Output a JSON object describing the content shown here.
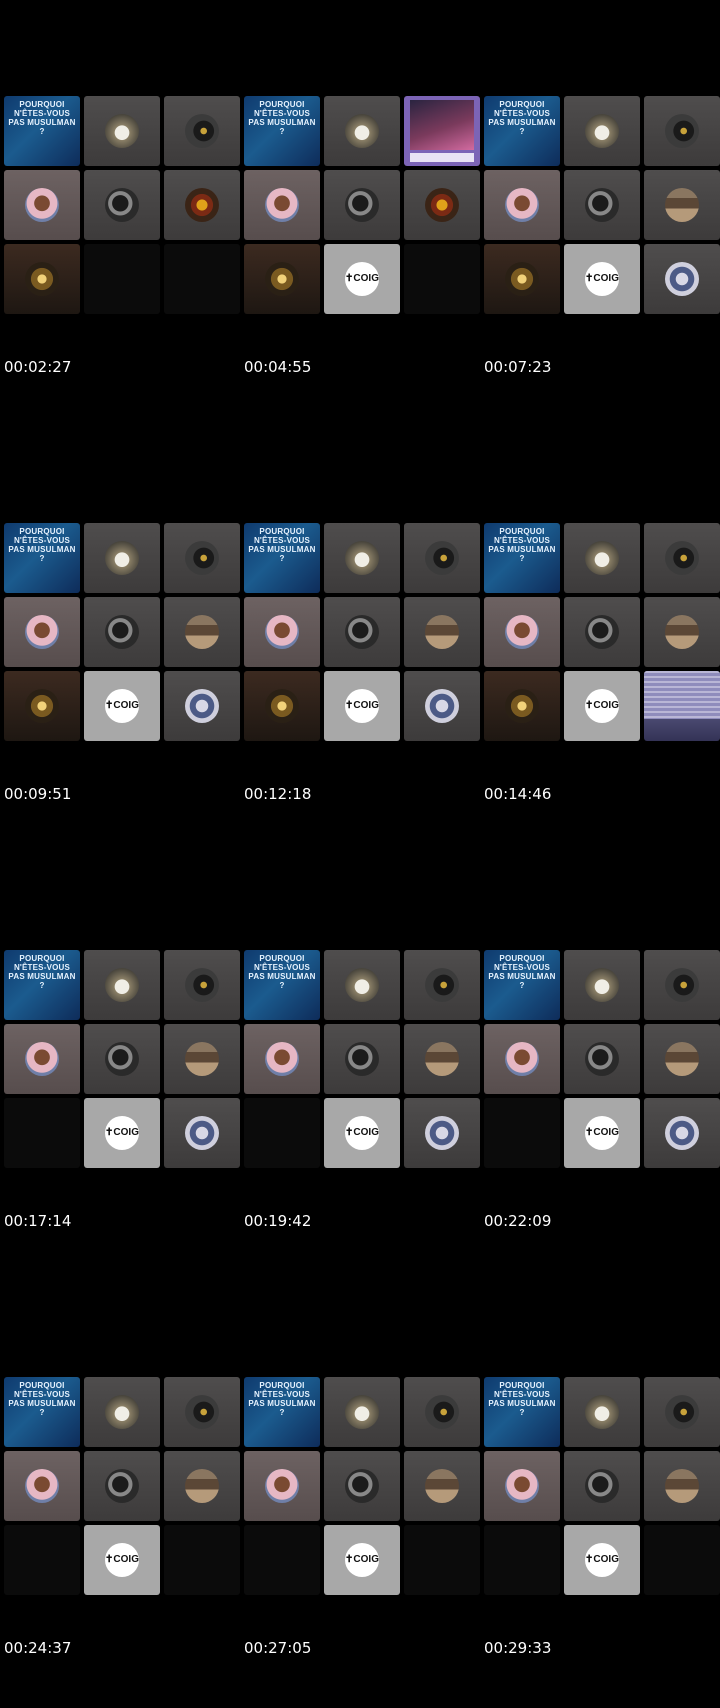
{
  "poster_text": "POURQUOI N'ÊTES-VOUS PAS MUSULMAN ?",
  "logo_text": "✝COIG",
  "thumbnails": [
    {
      "timestamp": "00:02:27",
      "tiles": [
        {
          "kind": "poster",
          "avatar": ""
        },
        {
          "kind": "grey",
          "avatar": "priest"
        },
        {
          "kind": "grey",
          "avatar": "bird"
        },
        {
          "kind": "pink",
          "avatar": "kid"
        },
        {
          "kind": "grey",
          "avatar": "dark"
        },
        {
          "kind": "grey",
          "avatar": "icon"
        },
        {
          "kind": "warm",
          "avatar": "bell"
        },
        {
          "kind": "black",
          "avatar": ""
        },
        {
          "kind": "black",
          "avatar": ""
        }
      ]
    },
    {
      "timestamp": "00:04:55",
      "tiles": [
        {
          "kind": "poster",
          "avatar": ""
        },
        {
          "kind": "grey",
          "avatar": "priest"
        },
        {
          "kind": "card",
          "avatar": ""
        },
        {
          "kind": "pink",
          "avatar": "kid"
        },
        {
          "kind": "grey",
          "avatar": "dark"
        },
        {
          "kind": "grey",
          "avatar": "icon"
        },
        {
          "kind": "warm",
          "avatar": "bell"
        },
        {
          "kind": "bright",
          "avatar": "logo"
        },
        {
          "kind": "black",
          "avatar": ""
        }
      ]
    },
    {
      "timestamp": "00:07:23",
      "tiles": [
        {
          "kind": "poster",
          "avatar": ""
        },
        {
          "kind": "grey",
          "avatar": "priest"
        },
        {
          "kind": "grey",
          "avatar": "bird"
        },
        {
          "kind": "pink",
          "avatar": "kid"
        },
        {
          "kind": "grey",
          "avatar": "dark"
        },
        {
          "kind": "grey",
          "avatar": "church"
        },
        {
          "kind": "warm",
          "avatar": "bell"
        },
        {
          "kind": "bright",
          "avatar": "logo"
        },
        {
          "kind": "grey",
          "avatar": "stand"
        }
      ]
    },
    {
      "timestamp": "00:09:51",
      "tiles": [
        {
          "kind": "poster",
          "avatar": ""
        },
        {
          "kind": "grey",
          "avatar": "priest"
        },
        {
          "kind": "grey",
          "avatar": "bird"
        },
        {
          "kind": "pink",
          "avatar": "kid"
        },
        {
          "kind": "grey",
          "avatar": "dark"
        },
        {
          "kind": "grey",
          "avatar": "church"
        },
        {
          "kind": "warm",
          "avatar": "bell"
        },
        {
          "kind": "bright",
          "avatar": "logo"
        },
        {
          "kind": "grey",
          "avatar": "stand"
        }
      ]
    },
    {
      "timestamp": "00:12:18",
      "tiles": [
        {
          "kind": "poster",
          "avatar": ""
        },
        {
          "kind": "grey",
          "avatar": "priest"
        },
        {
          "kind": "grey",
          "avatar": "bird"
        },
        {
          "kind": "pink",
          "avatar": "kid"
        },
        {
          "kind": "grey",
          "avatar": "dark"
        },
        {
          "kind": "grey",
          "avatar": "church"
        },
        {
          "kind": "warm",
          "avatar": "bell"
        },
        {
          "kind": "bright",
          "avatar": "logo"
        },
        {
          "kind": "grey",
          "avatar": "stand"
        }
      ]
    },
    {
      "timestamp": "00:14:46",
      "tiles": [
        {
          "kind": "poster",
          "avatar": ""
        },
        {
          "kind": "grey",
          "avatar": "priest"
        },
        {
          "kind": "grey",
          "avatar": "bird"
        },
        {
          "kind": "pink",
          "avatar": "kid"
        },
        {
          "kind": "grey",
          "avatar": "dark"
        },
        {
          "kind": "grey",
          "avatar": "church"
        },
        {
          "kind": "warm",
          "avatar": "bell"
        },
        {
          "kind": "bright",
          "avatar": "logo"
        },
        {
          "kind": "lav",
          "avatar": ""
        }
      ]
    },
    {
      "timestamp": "00:17:14",
      "tiles": [
        {
          "kind": "poster",
          "avatar": ""
        },
        {
          "kind": "grey",
          "avatar": "priest"
        },
        {
          "kind": "grey",
          "avatar": "bird"
        },
        {
          "kind": "pink",
          "avatar": "kid"
        },
        {
          "kind": "grey",
          "avatar": "dark"
        },
        {
          "kind": "grey",
          "avatar": "church"
        },
        {
          "kind": "black",
          "avatar": ""
        },
        {
          "kind": "bright",
          "avatar": "logo"
        },
        {
          "kind": "grey",
          "avatar": "stand"
        }
      ]
    },
    {
      "timestamp": "00:19:42",
      "tiles": [
        {
          "kind": "poster",
          "avatar": ""
        },
        {
          "kind": "grey",
          "avatar": "priest"
        },
        {
          "kind": "grey",
          "avatar": "bird"
        },
        {
          "kind": "pink",
          "avatar": "kid"
        },
        {
          "kind": "grey",
          "avatar": "dark"
        },
        {
          "kind": "grey",
          "avatar": "church"
        },
        {
          "kind": "black",
          "avatar": ""
        },
        {
          "kind": "bright",
          "avatar": "logo"
        },
        {
          "kind": "grey",
          "avatar": "stand"
        }
      ]
    },
    {
      "timestamp": "00:22:09",
      "tiles": [
        {
          "kind": "poster",
          "avatar": ""
        },
        {
          "kind": "grey",
          "avatar": "priest"
        },
        {
          "kind": "grey",
          "avatar": "bird"
        },
        {
          "kind": "pink",
          "avatar": "kid"
        },
        {
          "kind": "grey",
          "avatar": "dark"
        },
        {
          "kind": "grey",
          "avatar": "church"
        },
        {
          "kind": "black",
          "avatar": ""
        },
        {
          "kind": "bright",
          "avatar": "logo"
        },
        {
          "kind": "grey",
          "avatar": "stand"
        }
      ]
    },
    {
      "timestamp": "00:24:37",
      "tiles": [
        {
          "kind": "poster",
          "avatar": ""
        },
        {
          "kind": "grey",
          "avatar": "priest"
        },
        {
          "kind": "grey",
          "avatar": "bird"
        },
        {
          "kind": "pink",
          "avatar": "kid"
        },
        {
          "kind": "grey",
          "avatar": "dark"
        },
        {
          "kind": "grey",
          "avatar": "church"
        },
        {
          "kind": "black",
          "avatar": ""
        },
        {
          "kind": "bright",
          "avatar": "logo"
        },
        {
          "kind": "black",
          "avatar": ""
        }
      ]
    },
    {
      "timestamp": "00:27:05",
      "tiles": [
        {
          "kind": "poster",
          "avatar": ""
        },
        {
          "kind": "grey",
          "avatar": "priest"
        },
        {
          "kind": "grey",
          "avatar": "bird"
        },
        {
          "kind": "pink",
          "avatar": "kid"
        },
        {
          "kind": "grey",
          "avatar": "dark"
        },
        {
          "kind": "grey",
          "avatar": "church"
        },
        {
          "kind": "black",
          "avatar": ""
        },
        {
          "kind": "bright",
          "avatar": "logo"
        },
        {
          "kind": "black",
          "avatar": ""
        }
      ]
    },
    {
      "timestamp": "00:29:33",
      "tiles": [
        {
          "kind": "poster",
          "avatar": ""
        },
        {
          "kind": "grey",
          "avatar": "priest"
        },
        {
          "kind": "grey",
          "avatar": "bird"
        },
        {
          "kind": "pink",
          "avatar": "kid"
        },
        {
          "kind": "grey",
          "avatar": "dark"
        },
        {
          "kind": "grey",
          "avatar": "church"
        },
        {
          "kind": "black",
          "avatar": ""
        },
        {
          "kind": "bright",
          "avatar": "logo"
        },
        {
          "kind": "black",
          "avatar": ""
        }
      ]
    }
  ]
}
